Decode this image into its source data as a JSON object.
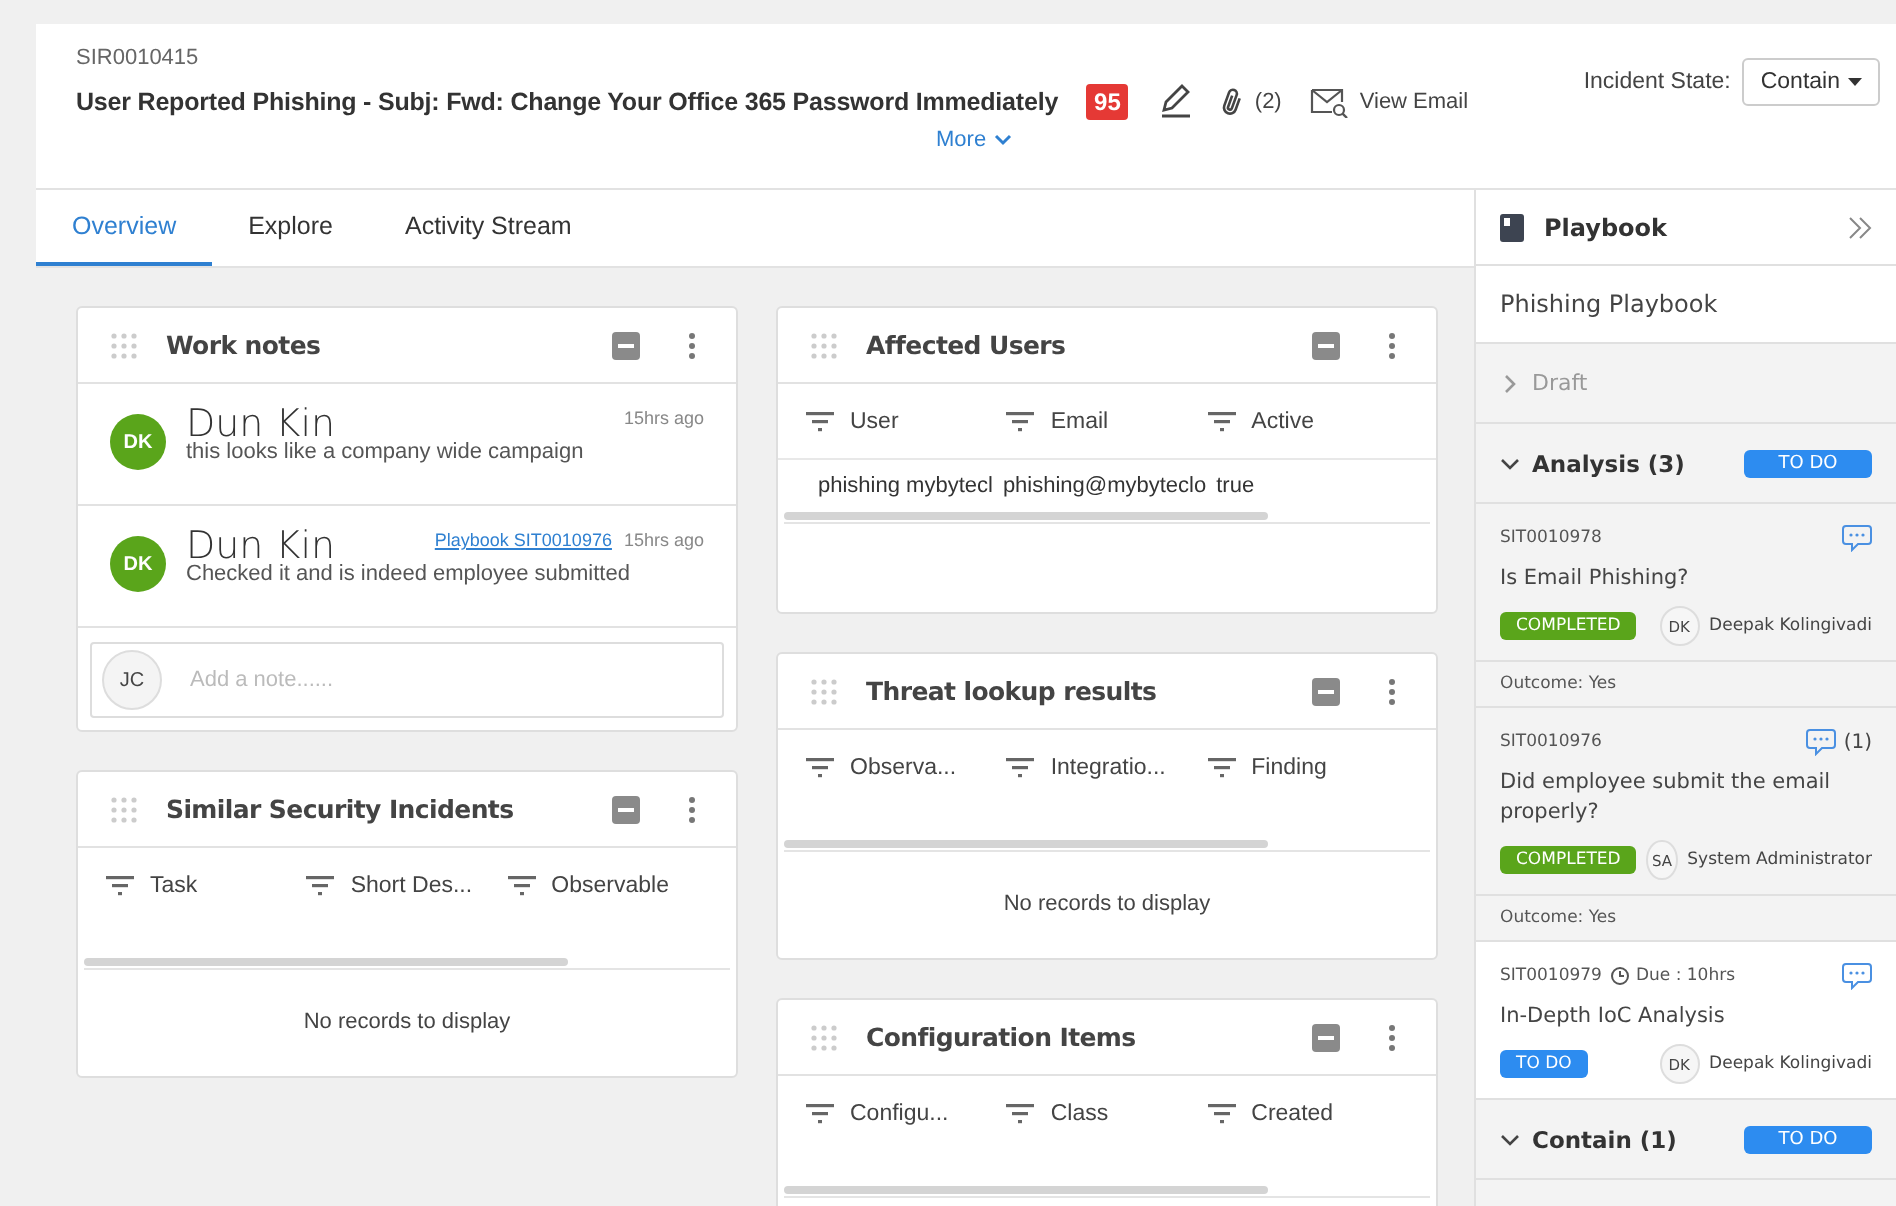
{
  "record": {
    "number": "SIR0010415",
    "title": "User Reported Phishing - Subj: Fwd: Change Your Office 365 Password Immediately",
    "risk_score": "95",
    "attachments": "(2)",
    "view_email": "View Email",
    "more": "More",
    "state_label": "Incident State:",
    "state_value": "Contain"
  },
  "tabs": [
    {
      "label": "Overview",
      "selected": true
    },
    {
      "label": "Explore",
      "selected": false
    },
    {
      "label": "Activity Stream",
      "selected": false
    }
  ],
  "work_notes": {
    "title": "Work notes",
    "notes": [
      {
        "initials": "DK",
        "author": "Dun Kin",
        "text": "this looks like a company wide campaign",
        "time": "15hrs ago"
      },
      {
        "initials": "DK",
        "author": "Dun Kin",
        "text": "Checked it and is indeed employee submitted",
        "link": "Playbook SIT0010976",
        "time": "15hrs ago"
      }
    ],
    "composer": {
      "initials": "JC",
      "placeholder": "Add a note......"
    }
  },
  "similar_incidents": {
    "title": "Similar Security Incidents",
    "columns": [
      "Task",
      "Short Des...",
      "Observable"
    ],
    "empty": "No records to display"
  },
  "affected_users": {
    "title": "Affected Users",
    "columns": [
      "User",
      "Email",
      "Active"
    ],
    "rows": [
      [
        "phishing mybytecl",
        "phishing@mybyteclo",
        "true"
      ]
    ]
  },
  "threat_lookup": {
    "title": "Threat lookup results",
    "columns": [
      "Observa...",
      "Integratio...",
      "Finding"
    ],
    "empty": "No records to display"
  },
  "configuration_items": {
    "title": "Configuration Items",
    "columns": [
      "Configu...",
      "Class",
      "Created"
    ]
  },
  "playbook": {
    "title": "Playbook",
    "name": "Phishing Playbook",
    "phases": [
      {
        "name": "Draft",
        "expanded": false
      },
      {
        "name": "Analysis (3)",
        "expanded": true,
        "status": "TO DO",
        "tasks": [
          {
            "number": "SIT0010978",
            "title": "Is Email Phishing?",
            "kind": "completed",
            "status": "COMPLETED",
            "initials": "DK",
            "assignee": "Deepak Kolingivadi",
            "outcome": "Outcome: Yes"
          },
          {
            "number": "SIT0010976",
            "title": "Did employee submit the email properly?",
            "kind": "completed",
            "status": "COMPLETED",
            "initials": "SA",
            "assignee": "System Administrator",
            "comments": "(1)",
            "outcome": "Outcome: Yes"
          },
          {
            "number": "SIT0010979",
            "title": "In-Depth IoC Analysis",
            "kind": "todo",
            "status": "TO DO",
            "initials": "DK",
            "assignee": "Deepak Kolingivadi",
            "due": "Due : 10hrs"
          }
        ]
      },
      {
        "name": "Contain (1)",
        "expanded": true,
        "status": "TO DO"
      }
    ]
  }
}
